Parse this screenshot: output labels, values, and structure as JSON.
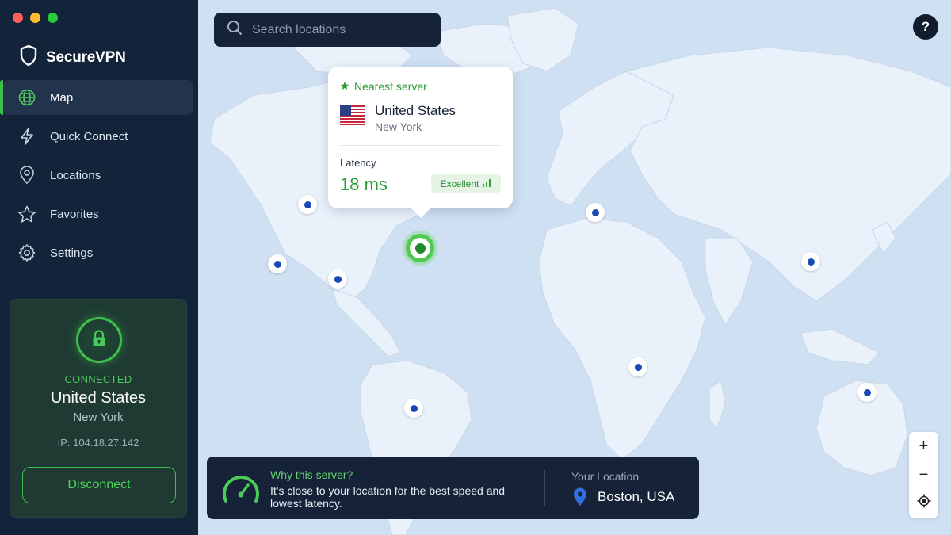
{
  "app": {
    "name": "SecureVPN"
  },
  "window": {
    "controls": [
      "#ff5f57",
      "#febc2e",
      "#28c840"
    ]
  },
  "sidebar": {
    "items": [
      {
        "label": "Map",
        "icon": "globe-icon",
        "active": true
      },
      {
        "label": "Quick Connect",
        "icon": "lightning-icon"
      },
      {
        "label": "Locations",
        "icon": "location-pin-icon"
      },
      {
        "label": "Favorites",
        "icon": "star-icon"
      },
      {
        "label": "Settings",
        "icon": "gear-icon"
      }
    ]
  },
  "status": {
    "state": "CONNECTED",
    "country": "United States",
    "city": "New York",
    "ip": "IP: 104.18.27.142",
    "disconnect_label": "Disconnect",
    "icon": "lock-icon"
  },
  "search": {
    "placeholder": "Search locations",
    "icon": "search-icon"
  },
  "help": {
    "label": "?"
  },
  "popup": {
    "heading": "Nearest server",
    "country": "United States",
    "city": "New York",
    "latency_label": "Latency",
    "latency_value": "18 ms",
    "quality": "Excellent",
    "flag": "us-flag-icon"
  },
  "info": {
    "title": "Why this server?",
    "text": "It's close to your location for the best speed and lowest latency.",
    "your_location_label": "Your Location",
    "your_location_value": "Boston, USA",
    "icon": "speedometer-icon"
  },
  "zoom": {
    "in": "+",
    "out": "−",
    "locate": "crosshair-icon"
  },
  "colors": {
    "accent": "#3fbf4c",
    "sidebar_bg": "#12233a",
    "map_bg": "#cfe0f3",
    "land": "#e9f1fa",
    "pin": "#1a48b5"
  }
}
